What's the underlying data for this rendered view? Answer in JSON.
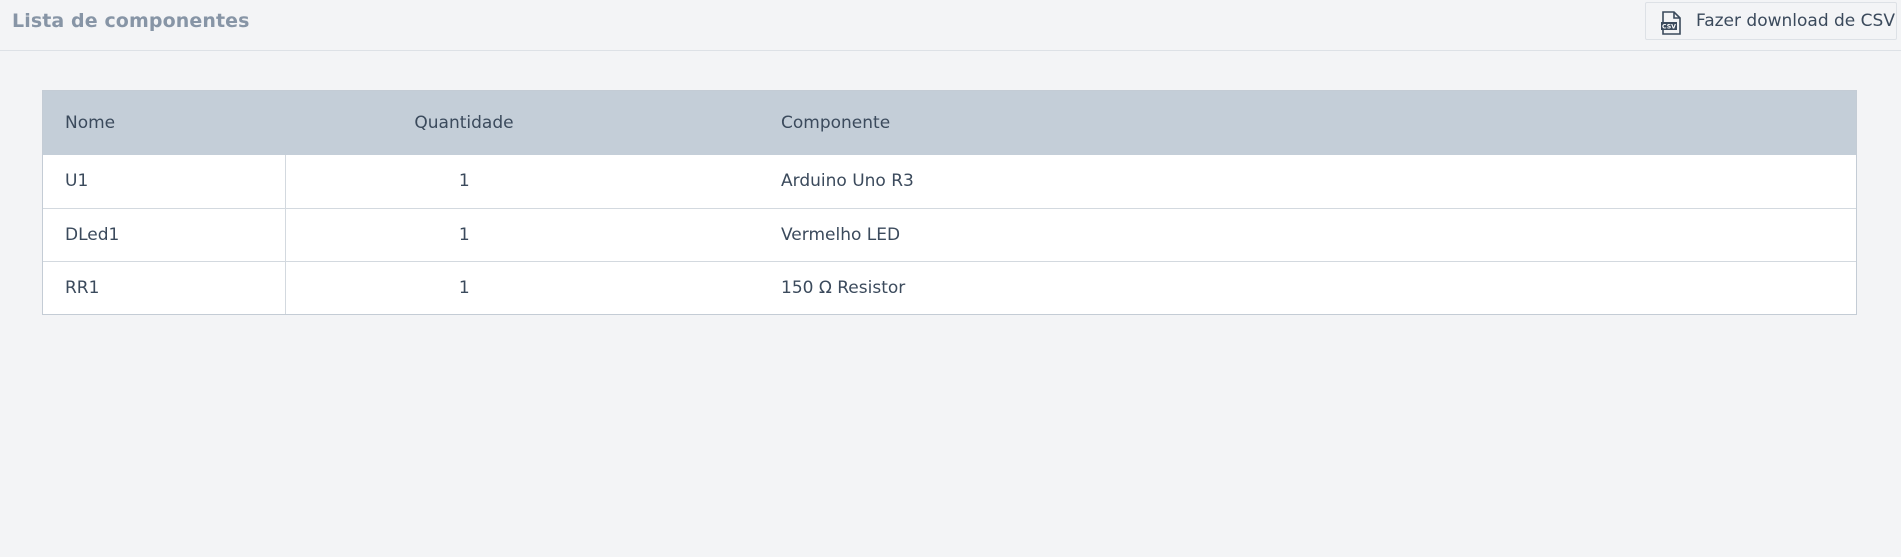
{
  "header": {
    "title": "Lista de componentes",
    "download_button_label": "Fazer download de CSV",
    "download_icon": "csv-file-icon"
  },
  "table": {
    "columns": [
      "Nome",
      "Quantidade",
      "Componente"
    ],
    "rows": [
      {
        "name": "U1",
        "quantity": "1",
        "component": "Arduino Uno R3"
      },
      {
        "name": "DLed1",
        "quantity": "1",
        "component": "Vermelho LED"
      },
      {
        "name": "RR1",
        "quantity": "1",
        "component": "150 Ω Resistor"
      }
    ]
  },
  "colors": {
    "background": "#f3f4f6",
    "header_row": "#c4ced8",
    "title_text": "#8795a6",
    "body_text": "#3b4a5c"
  }
}
